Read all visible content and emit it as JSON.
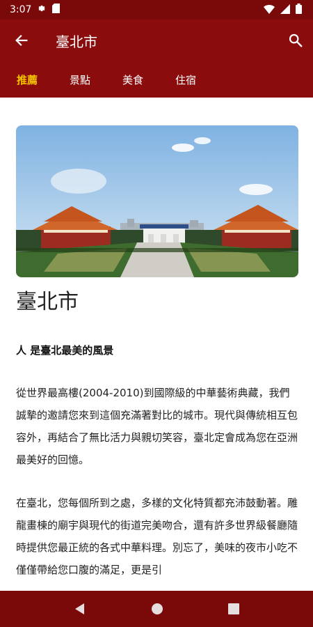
{
  "status_bar": {
    "time": "3:07",
    "icons": [
      "gear-icon",
      "sd-card-icon",
      "wifi-icon",
      "signal-icon",
      "battery-icon"
    ]
  },
  "app_bar": {
    "title": "臺北市",
    "back_icon": "arrow-back-icon",
    "search_icon": "search-icon"
  },
  "tabs": [
    {
      "label": "推薦",
      "active": true
    },
    {
      "label": "景點",
      "active": false
    },
    {
      "label": "美食",
      "active": false
    },
    {
      "label": "住宿",
      "active": false
    }
  ],
  "article": {
    "title": "臺北市",
    "subtitle": "人 是臺北最美的風景",
    "paragraphs": [
      "從世界最高樓(2004-2010)到國際級的中華藝術典藏，我們誠摯的邀請您來到這個充滿著對比的城市。現代與傳統相互包容外，再結合了無比活力與親切笑容，臺北定會成為您在亞洲最美好的回憶。",
      "在臺北，您每個所到之處，多樣的文化特質都充沛鼓動著。雕龍畫棟的廟宇與現代的街道完美吻合，還有許多世界級餐廳隨時提供您最正統的各式中華料理。別忘了，美味的夜市小吃不僅僅帶給您口腹的滿足，更是引"
    ]
  },
  "colors": {
    "primary": "#8b0c0c",
    "status_bar": "#7a0a0a",
    "tab_active": "#f2c200"
  },
  "nav_bar": {
    "icons": [
      "back-triangle-icon",
      "home-circle-icon",
      "recents-square-icon"
    ]
  }
}
